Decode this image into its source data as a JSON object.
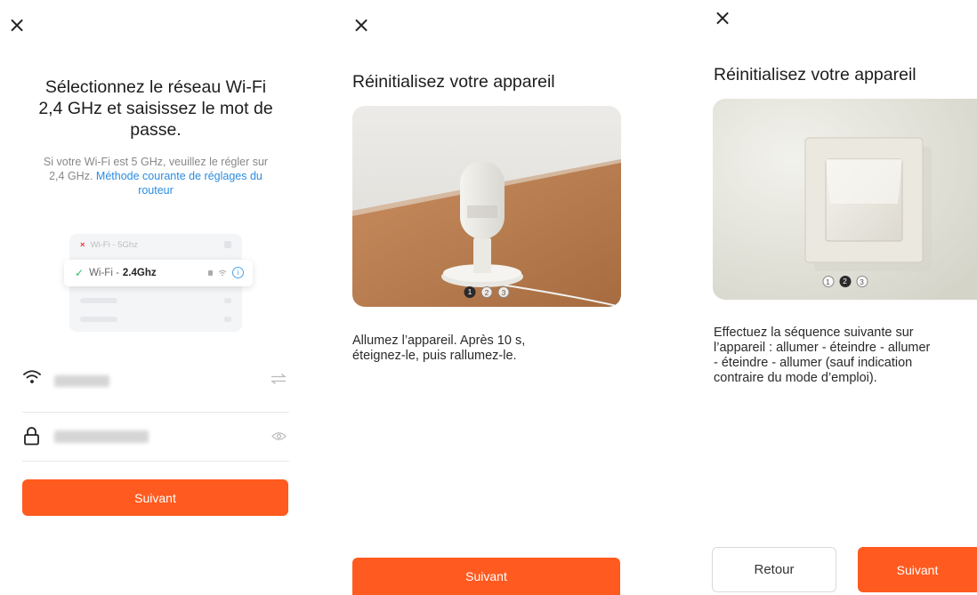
{
  "panel1": {
    "close_icon": "×",
    "title_lines": [
      "Sélectionnez le réseau Wi-Fi",
      "2,4 GHz et saisissez le mot de",
      "passe."
    ],
    "desc_lines": [
      "Si votre Wi-Fi est 5 GHz, veuillez le régler sur",
      "2,4 GHz."
    ],
    "desc_link_lines": [
      "Méthode courante de réglages du",
      "routeur"
    ],
    "wifi_list": {
      "first_item_mark": "×",
      "first_item_label": "Wi-Fi - 5Ghz",
      "selected_mark": "✓",
      "selected_prefix": "Wi-Fi -",
      "selected_band": "2.4Ghz",
      "info_icon": "i"
    },
    "ssid_icon": "wifi-icon",
    "switch_icon": "swap-icon",
    "password_icon": "lock-icon",
    "visibility_icon": "eye-icon",
    "next_button": "Suivant"
  },
  "panel2": {
    "close_icon": "×",
    "title": "Réinitialisez votre appareil",
    "pager": [
      "1",
      "2",
      "3"
    ],
    "active_page": 1,
    "text_lines": [
      "Allumez l’appareil. Après 10 s,",
      "éteignez-le, puis rallumez-le."
    ],
    "next_button": "Suivant"
  },
  "panel3": {
    "close_icon": "×",
    "title": "Réinitialisez votre appareil",
    "pager": [
      "1",
      "2",
      "3"
    ],
    "active_page": 2,
    "text_lines": [
      "Effectuez la séquence suivante sur",
      "l’appareil : allumer - éteindre - allumer",
      "- éteindre - allumer (sauf indication",
      "contraire du mode d’emploi)."
    ],
    "back_button": "Retour",
    "next_button": "Suivant"
  },
  "colors": {
    "accent": "#ff5a1f",
    "link": "#2c8ce0",
    "check": "#2dbb6a",
    "error": "#e53935"
  }
}
